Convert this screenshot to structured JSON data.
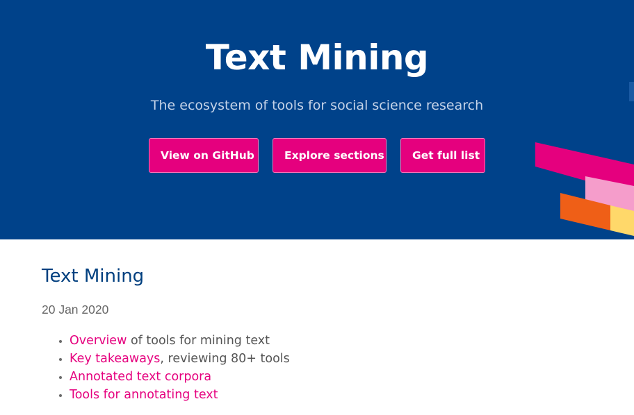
{
  "colors": {
    "hero_background": "#00428a",
    "accent_pink": "#e5007e",
    "title_blue": "#003f7f",
    "stripe_light_pink": "#f59dcb",
    "stripe_orange": "#ef5f17",
    "stripe_yellow": "#ffd86a"
  },
  "hero": {
    "title": "Text Mining",
    "subtitle": "The ecosystem of tools for social science research",
    "buttons": [
      {
        "label": "View on GitHub"
      },
      {
        "label": "Explore sections"
      },
      {
        "label": "Get full list"
      }
    ]
  },
  "post": {
    "title": "Text Mining",
    "date": "20 Jan 2020",
    "toc": [
      {
        "link": "Overview",
        "rest": " of tools for mining text"
      },
      {
        "link": "Key takeaways",
        "rest": ", reviewing 80+ tools"
      },
      {
        "link": "Annotated text corpora",
        "rest": ""
      },
      {
        "link": "Tools for annotating text",
        "rest": ""
      }
    ]
  },
  "icons": {
    "decoration": "diagonal-color-stripes"
  }
}
